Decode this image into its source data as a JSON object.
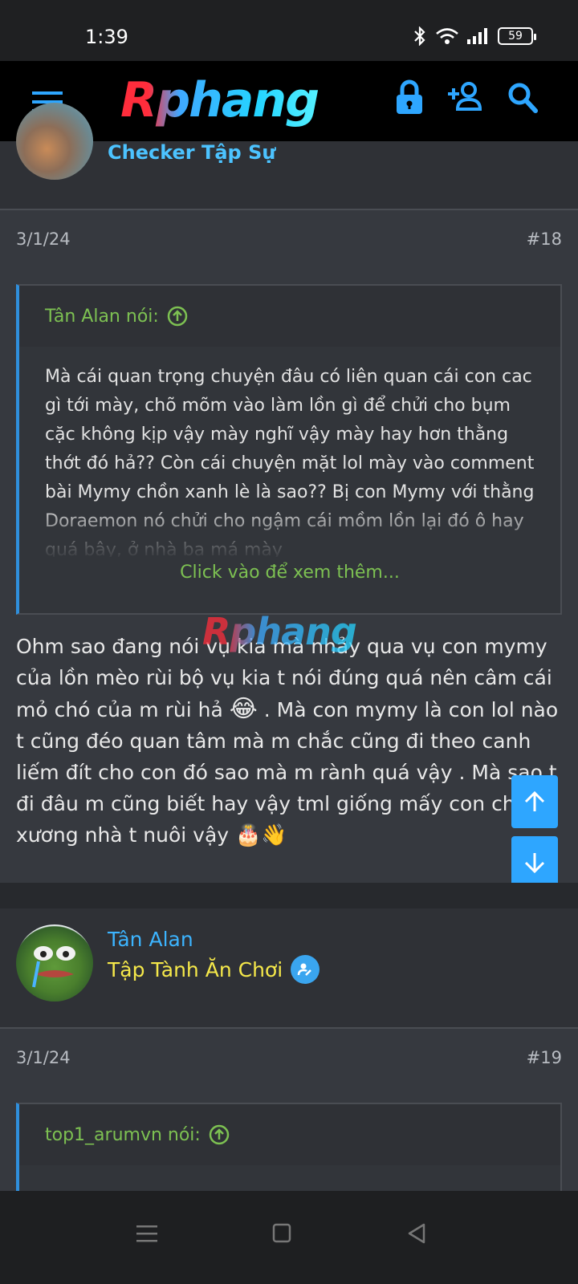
{
  "status_bar": {
    "time": "1:39",
    "battery": "59"
  },
  "header": {
    "logo": "Rphang"
  },
  "post18": {
    "author_title": "Checker Tập Sự",
    "date": "3/1/24",
    "number": "#18",
    "quote": {
      "author": "Tân Alan nói:",
      "text": "Mà cái quan trọng chuyện đâu có liên quan cái con cac gì tới mày, chõ mõm vào làm lồn gì để chửi cho bụm cặc không kịp vậy mày nghĩ vậy mày hay hơn thằng thớt đó hả?? Còn cái chuyện mặt lol mày vào comment bài Mymy chồn xanh lè là sao?? Bị con Mymy với thằng Doraemon nó chửi cho ngậm cái mồm lồn lại đó ô hay quá bây, ở nhà ba má mày",
      "expand": "Click vào để xem thêm..."
    },
    "message_part1": "Ohm sao đang nói vụ kia mà nhảy qua vụ con mymy của lồn mèo rùi bộ vụ kia t nói đúng quá nên câm cái mỏ chó của m rùi hả",
    "emoji1": "😂",
    "message_part2": ". Mà con mymy là con lol nào t cũng đéo quan tâm mà m chắc cũng đi theo canh liếm đít cho con đó sao mà m rành quá vậy . Mà sao t đi đâu m cũng biết hay vậy tml giống mấy con chó ăn xương nhà t nuôi vậy",
    "emoji2": "🎂👋"
  },
  "watermark": "Rphang",
  "post19": {
    "author": "Tân Alan",
    "author_title": "Tập Tành Ăn Chơi",
    "date": "3/1/24",
    "number": "#19",
    "quote": {
      "author": "top1_arumvn nói:"
    }
  }
}
